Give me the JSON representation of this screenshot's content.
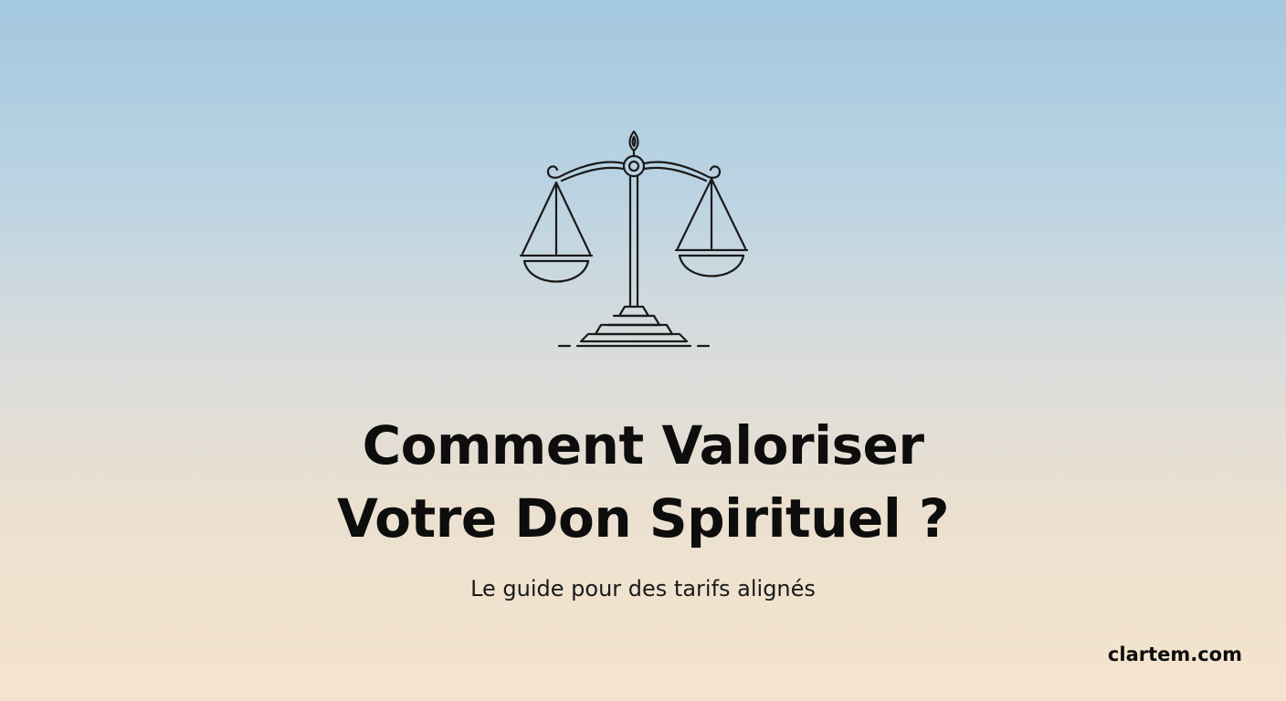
{
  "illustration": {
    "icon": "balance-scale-icon",
    "stroke_color": "#1a1a1a"
  },
  "title": {
    "line1": "Comment Valoriser",
    "line2": "Votre Don Spirituel ?"
  },
  "subtitle": "Le guide pour des tarifs alignés",
  "brand": "clartem.com",
  "colors": {
    "sky_top": "#a3c8e0",
    "warm_bottom": "#f5e4cd",
    "text": "#0d0d0d"
  }
}
